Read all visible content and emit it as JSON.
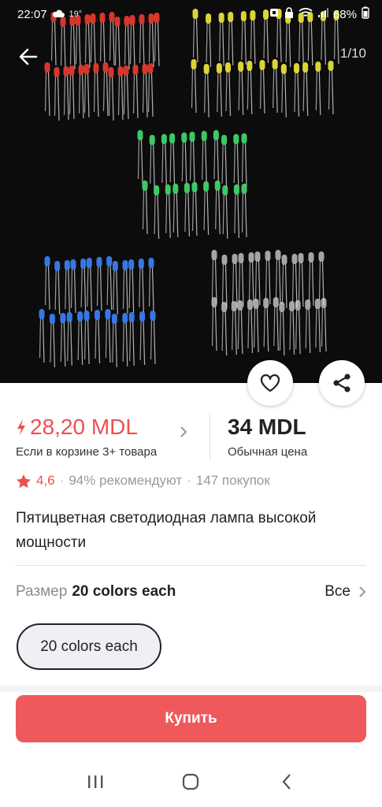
{
  "status_bar": {
    "time": "22:07",
    "temperature": "19°",
    "battery": "68%",
    "icons": [
      "weather-icon",
      "alarm-icon",
      "lock-icon",
      "wifi-icon",
      "signal-icon",
      "battery-icon"
    ]
  },
  "gallery": {
    "counter": "1/10",
    "led_colors": [
      "#e03a2e",
      "#e8df3a",
      "#3fd46a",
      "#3a7df0",
      "#e7e7e7"
    ]
  },
  "price": {
    "promo": "28,20 MDL",
    "promo_note": "Если в корзине 3+ товара",
    "regular": "34 MDL",
    "regular_note": "Обычная цена",
    "promo_color": "#f04f4f"
  },
  "rating": {
    "value": "4,6",
    "recommend": "94% рекомендуют",
    "purchases": "147 покупок"
  },
  "product": {
    "title": "Пятицветная светодиодная лампа высокой мощности"
  },
  "size": {
    "label": "Размер",
    "value": "20 colors each",
    "all_label": "Все",
    "options": [
      "20 colors each"
    ]
  },
  "actions": {
    "buy_label": "Купить",
    "buy_color": "#f0595c"
  }
}
